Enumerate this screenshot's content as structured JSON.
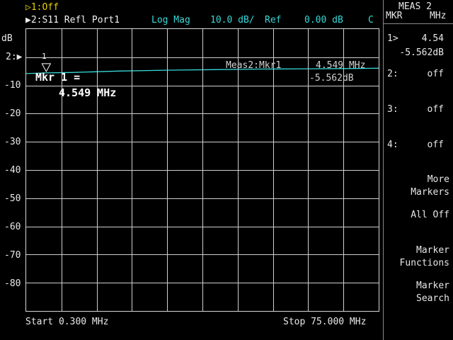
{
  "status": {
    "ch1": "▷1:Off",
    "ch2": "▶2:S11 Refl Port1",
    "format": "Log Mag",
    "scale": "10.0 dB/",
    "ref": "Ref",
    "ref_value": "0.00 dB",
    "cal_flag": "C"
  },
  "menu": {
    "title": "MEAS 2",
    "units_left": "MKR",
    "units_right": "MHz",
    "items": [
      {
        "label": "1>",
        "value": "4.54",
        "subvalue": "-5.562dB"
      },
      {
        "label": "2:",
        "value": "off"
      },
      {
        "label": "3:",
        "value": "off"
      },
      {
        "label": "4:",
        "value": "off"
      }
    ],
    "more_markers": [
      "More",
      "Markers"
    ],
    "all_off": "All Off",
    "marker_functions": [
      "Marker",
      "Functions"
    ],
    "marker_search": [
      "Marker",
      "Search"
    ]
  },
  "axis": {
    "unit": "dB",
    "ref_label": "2:▶",
    "y_ticks": [
      "-10",
      "-20",
      "-30",
      "-40",
      "-50",
      "-60",
      "-70",
      "-80"
    ],
    "start": "Start 0.300 MHz",
    "stop": "Stop 75.000 MHz"
  },
  "marker": {
    "number": "1",
    "label_line1": "Mkr 1 =",
    "label_line2": "4.549 MHz",
    "readout_name": "Meas2:Mkr1",
    "readout_freq": "4.549 MHz",
    "readout_value": "-5.562dB"
  },
  "colors": {
    "trace": "#38d8d8",
    "channel1": "#e6d200",
    "grid": "#cfcfcf"
  },
  "chart_data": {
    "type": "line",
    "x": [
      0.3,
      4.549,
      10,
      20,
      30,
      40,
      50,
      60,
      70,
      75
    ],
    "values": [
      -5.8,
      -5.562,
      -5.4,
      -4.9,
      -4.6,
      -4.4,
      -4.2,
      -4.1,
      -4.0,
      -3.9
    ],
    "xlim": [
      0.3,
      75.0
    ],
    "ylim": [
      -90,
      10
    ],
    "grid": true
  }
}
